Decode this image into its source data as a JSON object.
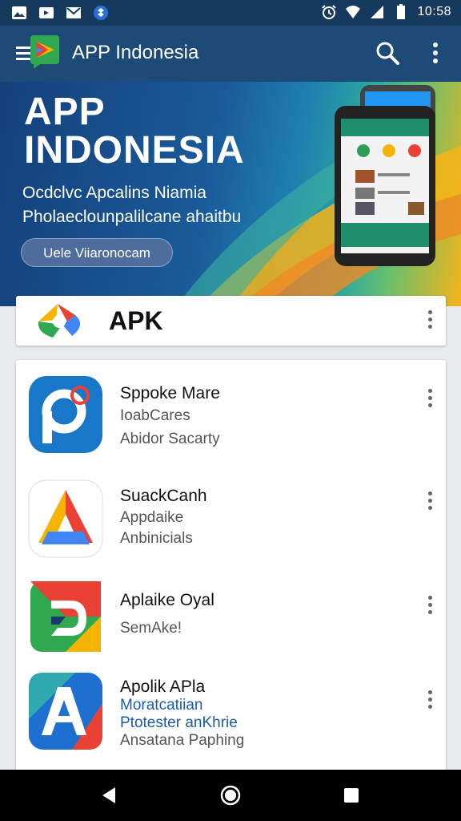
{
  "status_bar": {
    "time": "10:58",
    "icons": [
      "image-icon",
      "video-icon",
      "mail-icon",
      "dropbox-icon",
      "alarm-icon",
      "wifi-icon",
      "signal-icon",
      "battery-icon"
    ]
  },
  "app_bar": {
    "title": "APP Indonesia",
    "icons": [
      "menu-icon",
      "app-logo",
      "search-icon",
      "more-vert-icon"
    ]
  },
  "banner": {
    "title_line1": "APP",
    "title_line2": "INDONESIA",
    "subtitle_line1": "Ocdclvc Apcalins Niamia",
    "subtitle_line2": "Pholaeclounpalilcane ahaitbu",
    "button_label": "Uele Viiaronocam"
  },
  "apk_card": {
    "label": "APK"
  },
  "apps": [
    {
      "name": "Sppoke Mare",
      "lines": [
        "IoabCares",
        "Abidor Sacarty"
      ],
      "icon": "p-logo-icon"
    },
    {
      "name": "SuackCanh",
      "lines": [
        "Appdaike",
        "Anbinicials"
      ],
      "icon": "a-logo-icon"
    },
    {
      "name": "Aplaike Oyal",
      "lines": [
        "SemAke!"
      ],
      "icon": "d-logo-icon"
    },
    {
      "name": "Apolik APla",
      "lines": [
        "Moratcatiian",
        "Ptotester anKhrie",
        "Ansatana Paphing"
      ],
      "icon": "ap-logo-icon"
    }
  ],
  "colors": {
    "app_bar": "#1d4a76",
    "status_bar": "#153a5e",
    "accent_blue": "#1f5aa8",
    "orange": "#f6b417"
  }
}
